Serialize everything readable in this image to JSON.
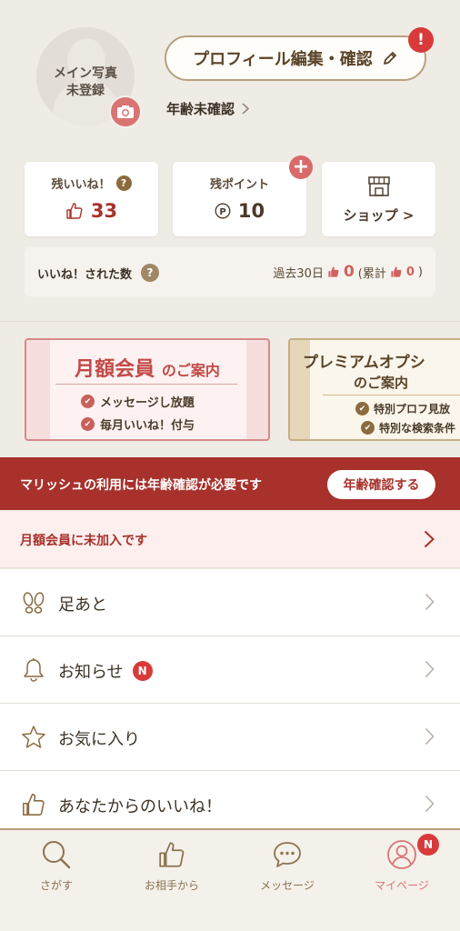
{
  "profile": {
    "photo_text_line1": "メイン写真",
    "photo_text_line2": "未登録",
    "edit_label": "プロフィール編集・確認",
    "alert_mark": "!",
    "age_status": "年齢未確認"
  },
  "stats": {
    "likes_title": "残いいね！",
    "likes_value": "33",
    "points_title": "残ポイント",
    "points_value": "10",
    "shop_label": "ショップ >",
    "help_mark": "?",
    "plus_mark": "+"
  },
  "received": {
    "label": "いいね！された数",
    "period_label": "過去30日",
    "period_value": "0",
    "total_label": "(累計",
    "total_value": "0",
    "close_paren": ")"
  },
  "banners": {
    "monthly_title_main": "月額会員",
    "monthly_title_sub": "のご案内",
    "monthly_item1": "メッセージし放題",
    "monthly_item2": "毎月いいね！付与",
    "premium_title": "プレミアムオプシ",
    "premium_sub": "のご案内",
    "premium_item1": "特別プロフ見放",
    "premium_item2": "特別な検索条件"
  },
  "age_banner": {
    "text": "マリッシュの利用には年齢確認が必要です",
    "button": "年齢確認する"
  },
  "monthly_row": {
    "text": "月額会員に未加入です"
  },
  "menu": {
    "footprints": "足あと",
    "notifications": "お知らせ",
    "notification_badge": "N",
    "favorites": "お気に入り",
    "your_likes": "あなたからのいいね！"
  },
  "tabs": {
    "search": "さがす",
    "from_partner": "お相手から",
    "messages": "メッセージ",
    "my_page": "マイページ",
    "my_page_badge": "N"
  },
  "colors": {
    "background": "#efebe5",
    "accent_red": "#a8312c",
    "accent_pink": "#d97474",
    "gold": "#8b6b3d"
  }
}
